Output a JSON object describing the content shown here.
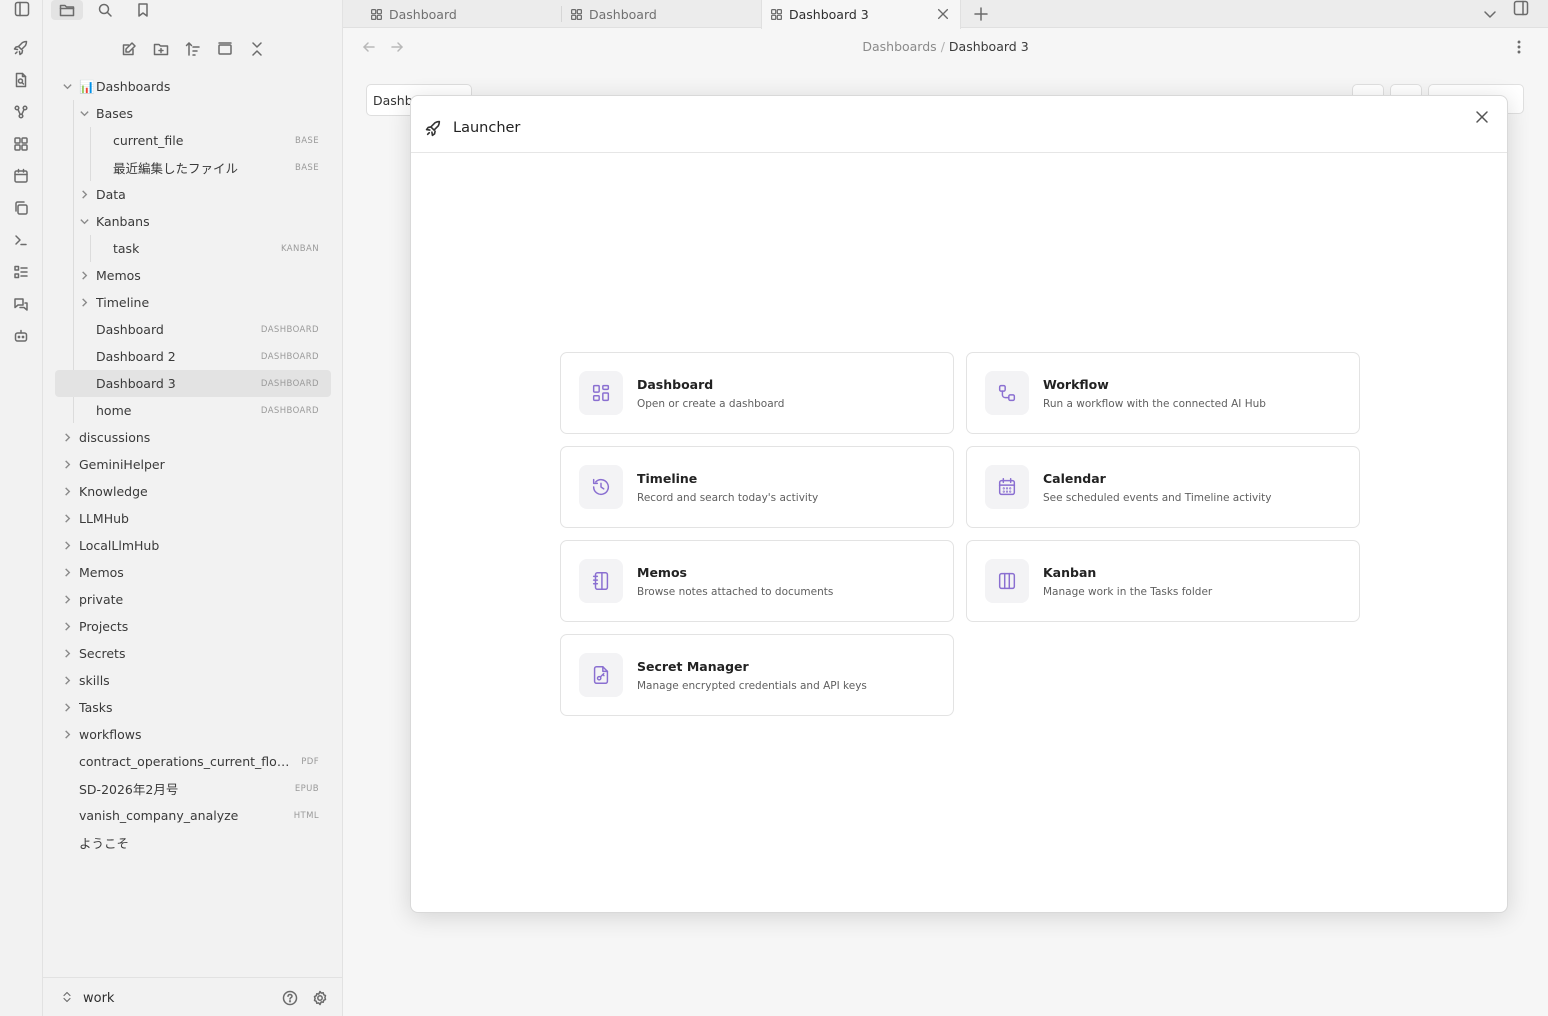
{
  "colors": {
    "accent": "#8a6fd1",
    "background": "#f6f6f6",
    "sidebar": "#f2f2f2"
  },
  "tabs": [
    {
      "label": "Dashboard",
      "icon": "dashboard-icon"
    },
    {
      "label": "Dashboard",
      "icon": "dashboard-icon"
    },
    {
      "label": "Dashboard 3",
      "icon": "dashboard-icon",
      "active": true
    }
  ],
  "breadcrumb": {
    "parent": "Dashboards",
    "separator": "/",
    "current": "Dashboard 3"
  },
  "background_view": {
    "input_value": "Dashb"
  },
  "tree": [
    {
      "label": "Dashboards",
      "level": 0,
      "expanded": true,
      "emoji": "📊"
    },
    {
      "label": "Bases",
      "level": 1,
      "expanded": true
    },
    {
      "label": "current_file",
      "level": 2,
      "badge": "BASE"
    },
    {
      "label": "最近編集したファイル",
      "level": 2,
      "badge": "BASE"
    },
    {
      "label": "Data",
      "level": 1,
      "expanded": false
    },
    {
      "label": "Kanbans",
      "level": 1,
      "expanded": true
    },
    {
      "label": "task",
      "level": 2,
      "badge": "KANBAN"
    },
    {
      "label": "Memos",
      "level": 1,
      "expanded": false
    },
    {
      "label": "Timeline",
      "level": 1,
      "expanded": false
    },
    {
      "label": "Dashboard",
      "level": 1,
      "badge": "DASHBOARD"
    },
    {
      "label": "Dashboard 2",
      "level": 1,
      "badge": "DASHBOARD"
    },
    {
      "label": "Dashboard 3",
      "level": 1,
      "badge": "DASHBOARD",
      "selected": true
    },
    {
      "label": "home",
      "level": 1,
      "badge": "DASHBOARD"
    },
    {
      "label": "discussions",
      "level": 0,
      "expanded": false
    },
    {
      "label": "GeminiHelper",
      "level": 0,
      "expanded": false
    },
    {
      "label": "Knowledge",
      "level": 0,
      "expanded": false
    },
    {
      "label": "LLMHub",
      "level": 0,
      "expanded": false
    },
    {
      "label": "LocalLlmHub",
      "level": 0,
      "expanded": false
    },
    {
      "label": "Memos",
      "level": 0,
      "expanded": false
    },
    {
      "label": "private",
      "level": 0,
      "expanded": false
    },
    {
      "label": "Projects",
      "level": 0,
      "expanded": false
    },
    {
      "label": "Secrets",
      "level": 0,
      "expanded": false
    },
    {
      "label": "skills",
      "level": 0,
      "expanded": false
    },
    {
      "label": "Tasks",
      "level": 0,
      "expanded": false
    },
    {
      "label": "workflows",
      "level": 0,
      "expanded": false
    },
    {
      "label": "contract_operations_current_flow_sc...",
      "level": 0,
      "badge": "PDF"
    },
    {
      "label": "SD-2026年2月号",
      "level": 0,
      "badge": "EPUB"
    },
    {
      "label": "vanish_company_analyze",
      "level": 0,
      "badge": "HTML"
    },
    {
      "label": "ようこそ",
      "level": 0
    }
  ],
  "vault": {
    "name": "work"
  },
  "launcher": {
    "title": "Launcher",
    "items": [
      {
        "title": "Dashboard",
        "desc": "Open or create a dashboard",
        "icon": "dashboard-icon"
      },
      {
        "title": "Workflow",
        "desc": "Run a workflow with the connected AI Hub",
        "icon": "workflow-icon"
      },
      {
        "title": "Timeline",
        "desc": "Record and search today's activity",
        "icon": "history-icon"
      },
      {
        "title": "Calendar",
        "desc": "See scheduled events and Timeline activity",
        "icon": "calendar-icon"
      },
      {
        "title": "Memos",
        "desc": "Browse notes attached to documents",
        "icon": "notebook-icon"
      },
      {
        "title": "Kanban",
        "desc": "Manage work in the Tasks folder",
        "icon": "kanban-icon"
      },
      {
        "title": "Secret Manager",
        "desc": "Manage encrypted credentials and API keys",
        "icon": "file-key-icon"
      }
    ]
  }
}
